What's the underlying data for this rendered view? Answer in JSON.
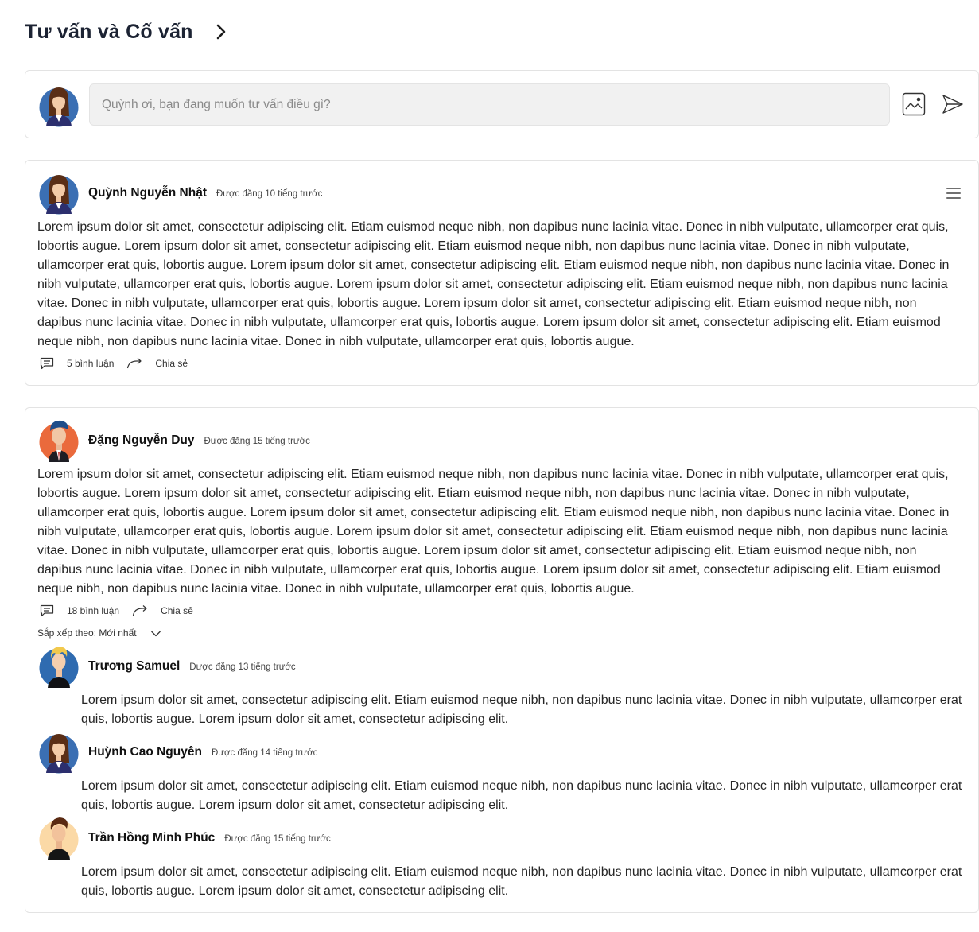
{
  "header": {
    "title": "Tư vấn và Cố vấn"
  },
  "composer": {
    "placeholder": "Quỳnh ơi, bạn đang muốn tư vấn điều gì?"
  },
  "posts": [
    {
      "author": "Quỳnh Nguyễn Nhật",
      "time": "Được đăng 10 tiếng trước",
      "body": "Lorem ipsum dolor sit amet, consectetur adipiscing elit. Etiam euismod neque nibh, non dapibus nunc lacinia vitae. Donec in nibh vulputate, ullamcorper erat quis, lobortis augue. Lorem ipsum dolor sit amet, consectetur adipiscing elit. Etiam euismod neque nibh, non dapibus nunc lacinia vitae. Donec in nibh vulputate, ullamcorper erat quis, lobortis augue. Lorem ipsum dolor sit amet, consectetur adipiscing elit. Etiam euismod neque nibh, non dapibus nunc lacinia vitae. Donec in nibh vulputate, ullamcorper erat quis, lobortis augue. Lorem ipsum dolor sit amet, consectetur adipiscing elit. Etiam euismod neque nibh, non dapibus nunc lacinia vitae. Donec in nibh vulputate, ullamcorper erat quis, lobortis augue. Lorem ipsum dolor sit amet, consectetur adipiscing elit. Etiam euismod neque nibh, non dapibus nunc lacinia vitae. Donec in nibh vulputate, ullamcorper erat quis, lobortis augue. Lorem ipsum dolor sit amet, consectetur adipiscing elit. Etiam euismod neque nibh, non dapibus nunc lacinia vitae. Donec in nibh vulputate, ullamcorper erat quis, lobortis augue.",
      "comments_label": "5 bình luận",
      "share_label": "Chia sẻ"
    },
    {
      "author": "Đặng Nguyễn Duy",
      "time": "Được đăng 15 tiếng trước",
      "body": "Lorem ipsum dolor sit amet, consectetur adipiscing elit. Etiam euismod neque nibh, non dapibus nunc lacinia vitae. Donec in nibh vulputate, ullamcorper erat quis, lobortis augue. Lorem ipsum dolor sit amet, consectetur adipiscing elit. Etiam euismod neque nibh, non dapibus nunc lacinia vitae. Donec in nibh vulputate, ullamcorper erat quis, lobortis augue. Lorem ipsum dolor sit amet, consectetur adipiscing elit. Etiam euismod neque nibh, non dapibus nunc lacinia vitae. Donec in nibh vulputate, ullamcorper erat quis, lobortis augue. Lorem ipsum dolor sit amet, consectetur adipiscing elit. Etiam euismod neque nibh, non dapibus nunc lacinia vitae. Donec in nibh vulputate, ullamcorper erat quis, lobortis augue. Lorem ipsum dolor sit amet, consectetur adipiscing elit. Etiam euismod neque nibh, non dapibus nunc lacinia vitae. Donec in nibh vulputate, ullamcorper erat quis, lobortis augue. Lorem ipsum dolor sit amet, consectetur adipiscing elit. Etiam euismod neque nibh, non dapibus nunc lacinia vitae. Donec in nibh vulputate, ullamcorper erat quis, lobortis augue.",
      "comments_label": "18 bình luận",
      "share_label": "Chia sẻ",
      "sort_label": "Sắp xếp theo: Mới nhất",
      "comments": [
        {
          "author": "Trương Samuel",
          "time": "Được đăng 13 tiếng trước",
          "text": "Lorem ipsum dolor sit amet, consectetur adipiscing elit. Etiam euismod neque nibh, non dapibus nunc lacinia vitae. Donec in nibh vulputate, ullamcorper erat quis, lobortis augue. Lorem ipsum dolor sit amet, consectetur adipiscing elit."
        },
        {
          "author": "Huỳnh Cao Nguyên",
          "time": "Được đăng 14 tiếng trước",
          "text": "Lorem ipsum dolor sit amet, consectetur adipiscing elit. Etiam euismod neque nibh, non dapibus nunc lacinia vitae. Donec in nibh vulputate, ullamcorper erat quis, lobortis augue. Lorem ipsum dolor sit amet, consectetur adipiscing elit."
        },
        {
          "author": "Trần Hồng Minh Phúc",
          "time": "Được đăng 15 tiếng trước",
          "text": "Lorem ipsum dolor sit amet, consectetur adipiscing elit. Etiam euismod neque nibh, non dapibus nunc lacinia vitae. Donec in nibh vulputate, ullamcorper erat quis, lobortis augue. Lorem ipsum dolor sit amet, consectetur adipiscing elit."
        }
      ]
    }
  ]
}
